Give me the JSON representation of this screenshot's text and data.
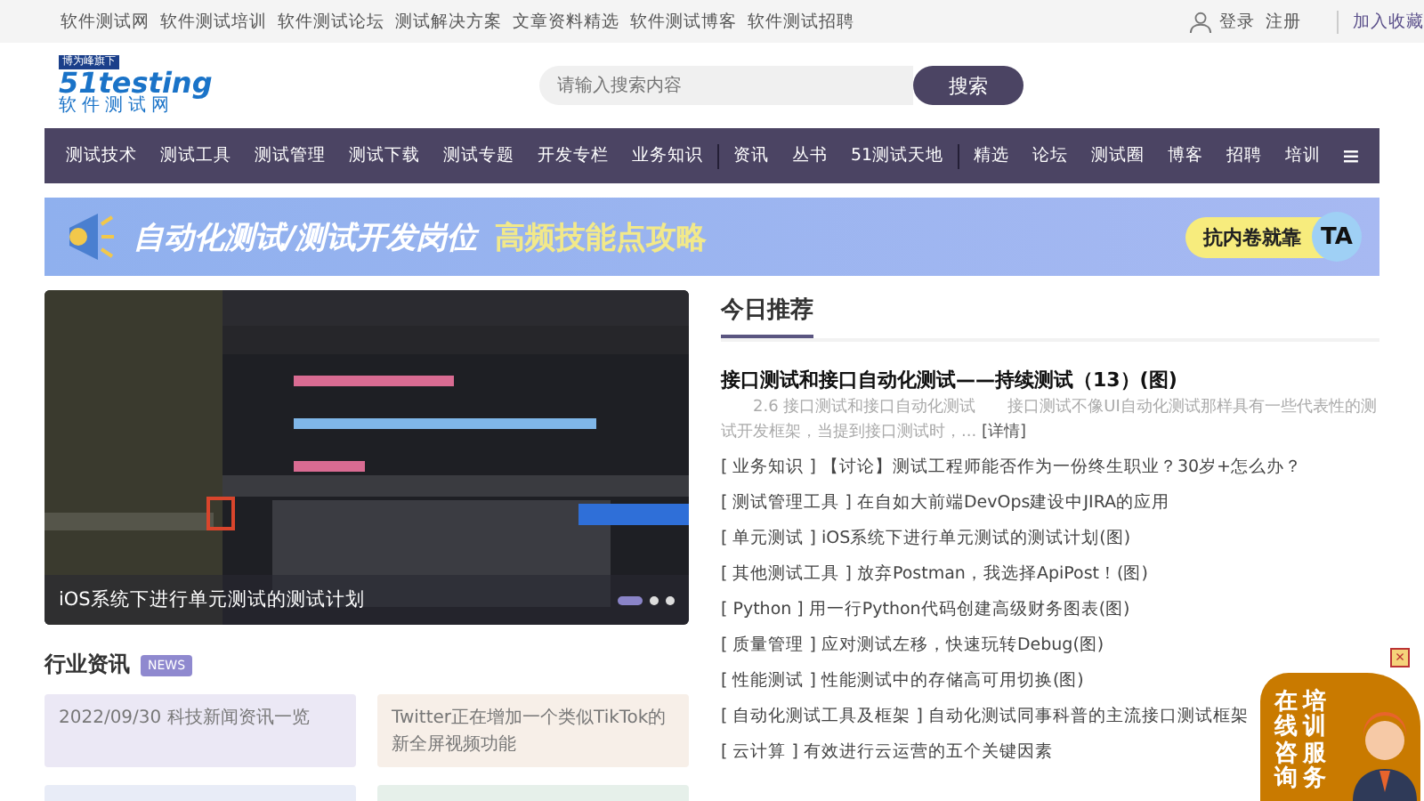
{
  "top_links": [
    "软件测试网",
    "软件测试培训",
    "软件测试论坛",
    "测试解决方案",
    "文章资料精选",
    "软件测试博客",
    "软件测试招聘"
  ],
  "account": {
    "login": "登录",
    "register": "注册",
    "bookmark": "加入收藏"
  },
  "logo": {
    "badge": "博为峰旗下",
    "brand": "51testing",
    "subtitle": "软件测试网"
  },
  "search": {
    "placeholder": "请输入搜索内容",
    "button": "搜索"
  },
  "nav": [
    {
      "label": "测试技术",
      "divider": false
    },
    {
      "label": "测试工具",
      "divider": false
    },
    {
      "label": "测试管理",
      "divider": false
    },
    {
      "label": "测试下载",
      "divider": false
    },
    {
      "label": "测试专题",
      "divider": false
    },
    {
      "label": "开发专栏",
      "divider": false
    },
    {
      "label": "业务知识",
      "divider": true
    },
    {
      "label": "资讯",
      "divider": false
    },
    {
      "label": "丛书",
      "divider": false
    },
    {
      "label": "51测试天地",
      "divider": true
    },
    {
      "label": "精选",
      "divider": false
    },
    {
      "label": "论坛",
      "divider": false
    },
    {
      "label": "测试圈",
      "divider": false
    },
    {
      "label": "博客",
      "divider": false
    },
    {
      "label": "招聘",
      "divider": false
    },
    {
      "label": "培训",
      "divider": false
    }
  ],
  "banner": {
    "title": "自动化测试/测试开发岗位",
    "highlight": "高频技能点攻略",
    "pill": "抗内卷就靠",
    "pill_badge": "TA"
  },
  "carousel": {
    "caption": "iOS系统下进行单元测试的测试计划",
    "dots": [
      {
        "selected": true
      },
      {
        "selected": false
      },
      {
        "selected": false
      }
    ]
  },
  "news": {
    "title": "行业资讯",
    "badge": "NEWS",
    "cards": [
      {
        "text": "2022/09/30 科技新闻资讯一览",
        "color": "#ebe8f5"
      },
      {
        "text": "Twitter正在增加一个类似TikTok的新全屏视频功能",
        "color": "#f7efe8"
      }
    ]
  },
  "recommend": {
    "title": "今日推荐",
    "headline": "接口测试和接口自动化测试——持续测试（13）(图)",
    "summary": "2.6 接口测试和接口自动化测试　　接口测试不像UI自动化测试那样具有一些代表性的测试开发框架，当提到接口测试时，...",
    "more": "[详情]",
    "items": [
      {
        "category": "[ 业务知识 ]",
        "title": "【讨论】测试工程师能否作为一份终生职业？30岁+怎么办？"
      },
      {
        "category": "[ 测试管理工具 ]",
        "title": "在自如大前端DevOps建设中JIRA的应用"
      },
      {
        "category": "[ 单元测试 ]",
        "title": "iOS系统下进行单元测试的测试计划(图)"
      },
      {
        "category": "[ 其他测试工具 ]",
        "title": "放弃Postman，我选择ApiPost！(图)"
      },
      {
        "category": "[ Python ]",
        "title": "用一行Python代码创建高级财务图表(图)"
      },
      {
        "category": "[ 质量管理 ]",
        "title": "应对测试左移，快速玩转Debug(图)"
      },
      {
        "category": "[ 性能测试 ]",
        "title": "性能测试中的存储高可用切换(图)"
      },
      {
        "category": "[ 自动化测试工具及框架 ]",
        "title": "自动化测试同事科普的主流接口测试框架"
      },
      {
        "category": "[ 云计算 ]",
        "title": "有效进行云运营的五个关键因素"
      }
    ]
  },
  "float_widget": {
    "left": "在线咨询",
    "right": "培训服务",
    "close": "×"
  }
}
